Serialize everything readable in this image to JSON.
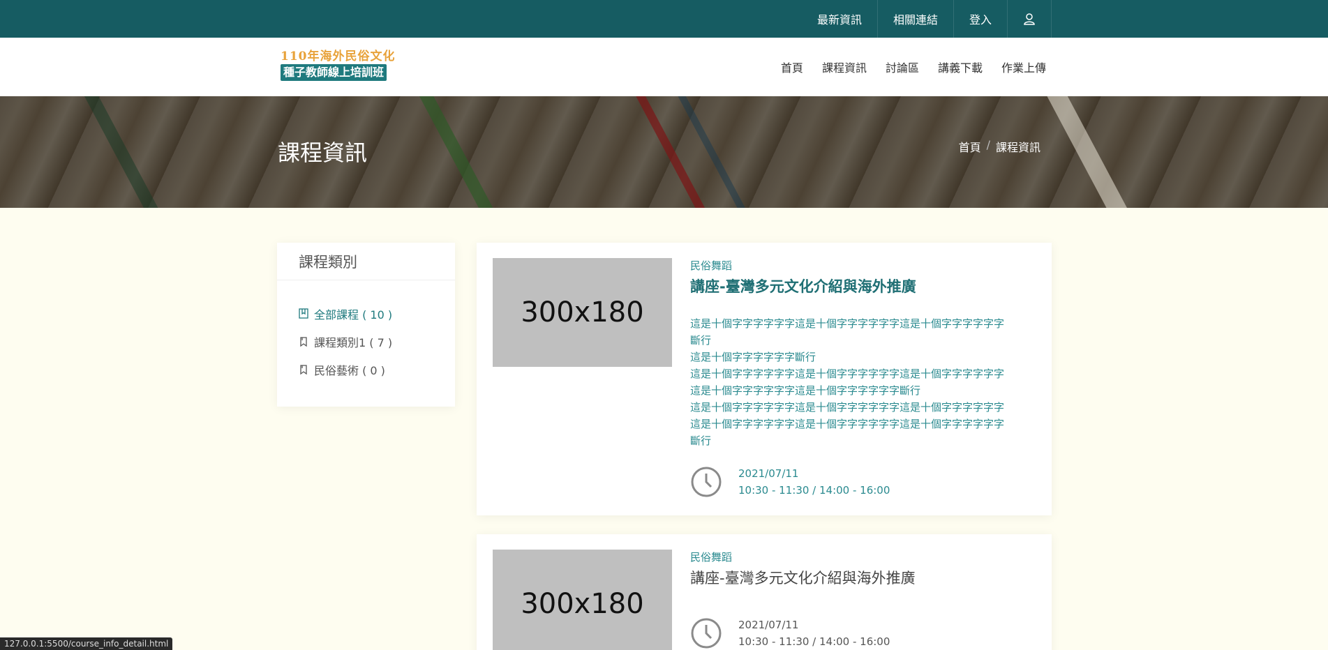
{
  "topbar": {
    "links": [
      "最新資訊",
      "相關連結",
      "登入"
    ],
    "user_icon": "user-icon"
  },
  "logo": {
    "line1": "110年海外民俗文化",
    "line2": "種子教師線上培訓班"
  },
  "nav": [
    "首頁",
    "課程資訊",
    "討論區",
    "講義下載",
    "作業上傳"
  ],
  "banner": {
    "title": "課程資訊",
    "breadcrumb": [
      "首頁",
      "課程資訊"
    ]
  },
  "sidebar": {
    "title": "課程類別",
    "items": [
      {
        "label": "全部課程 ( 10 )",
        "icon": "book-icon",
        "active": true
      },
      {
        "label": "課程類別1 ( 7 )",
        "icon": "bookmark-icon",
        "active": false
      },
      {
        "label": "民俗藝術 ( 0 )",
        "icon": "bookmark-icon",
        "active": false
      }
    ]
  },
  "courses": [
    {
      "thumb": "300x180",
      "category": "民俗舞蹈",
      "title": "講座-臺灣多元文化介紹與海外推廣",
      "desc": "這是十個字字字字字字這是十個字字字字字字這是十個字字字字字字\n斷行\n這是十個字字字字字字斷行\n這是十個字字字字字字這是十個字字字字字字這是十個字字字字字字\n這是十個字字字字字字這是十個字字字字字字斷行\n這是十個字字字字字字這是十個字字字字字字這是十個字字字字字字\n這是十個字字字字字字這是十個字字字字字字這是十個字字字字字字\n斷行",
      "date": "2021/07/11",
      "time": "10:30 - 11:30 / 14:00 - 16:00"
    },
    {
      "thumb": "300x180",
      "category": "民俗舞蹈",
      "title": "講座-臺灣多元文化介紹與海外推廣",
      "desc": "",
      "date": "2021/07/11",
      "time": "10:30 - 11:30 / 14:00 - 16:00"
    }
  ],
  "statusbar": "127.0.0.1:5500/course_info_detail.html",
  "colors": {
    "topbar": "#165c62",
    "accent": "#1f7a7e",
    "page_bg": "#fefdf0",
    "logo_gold": "#e8a23a"
  }
}
